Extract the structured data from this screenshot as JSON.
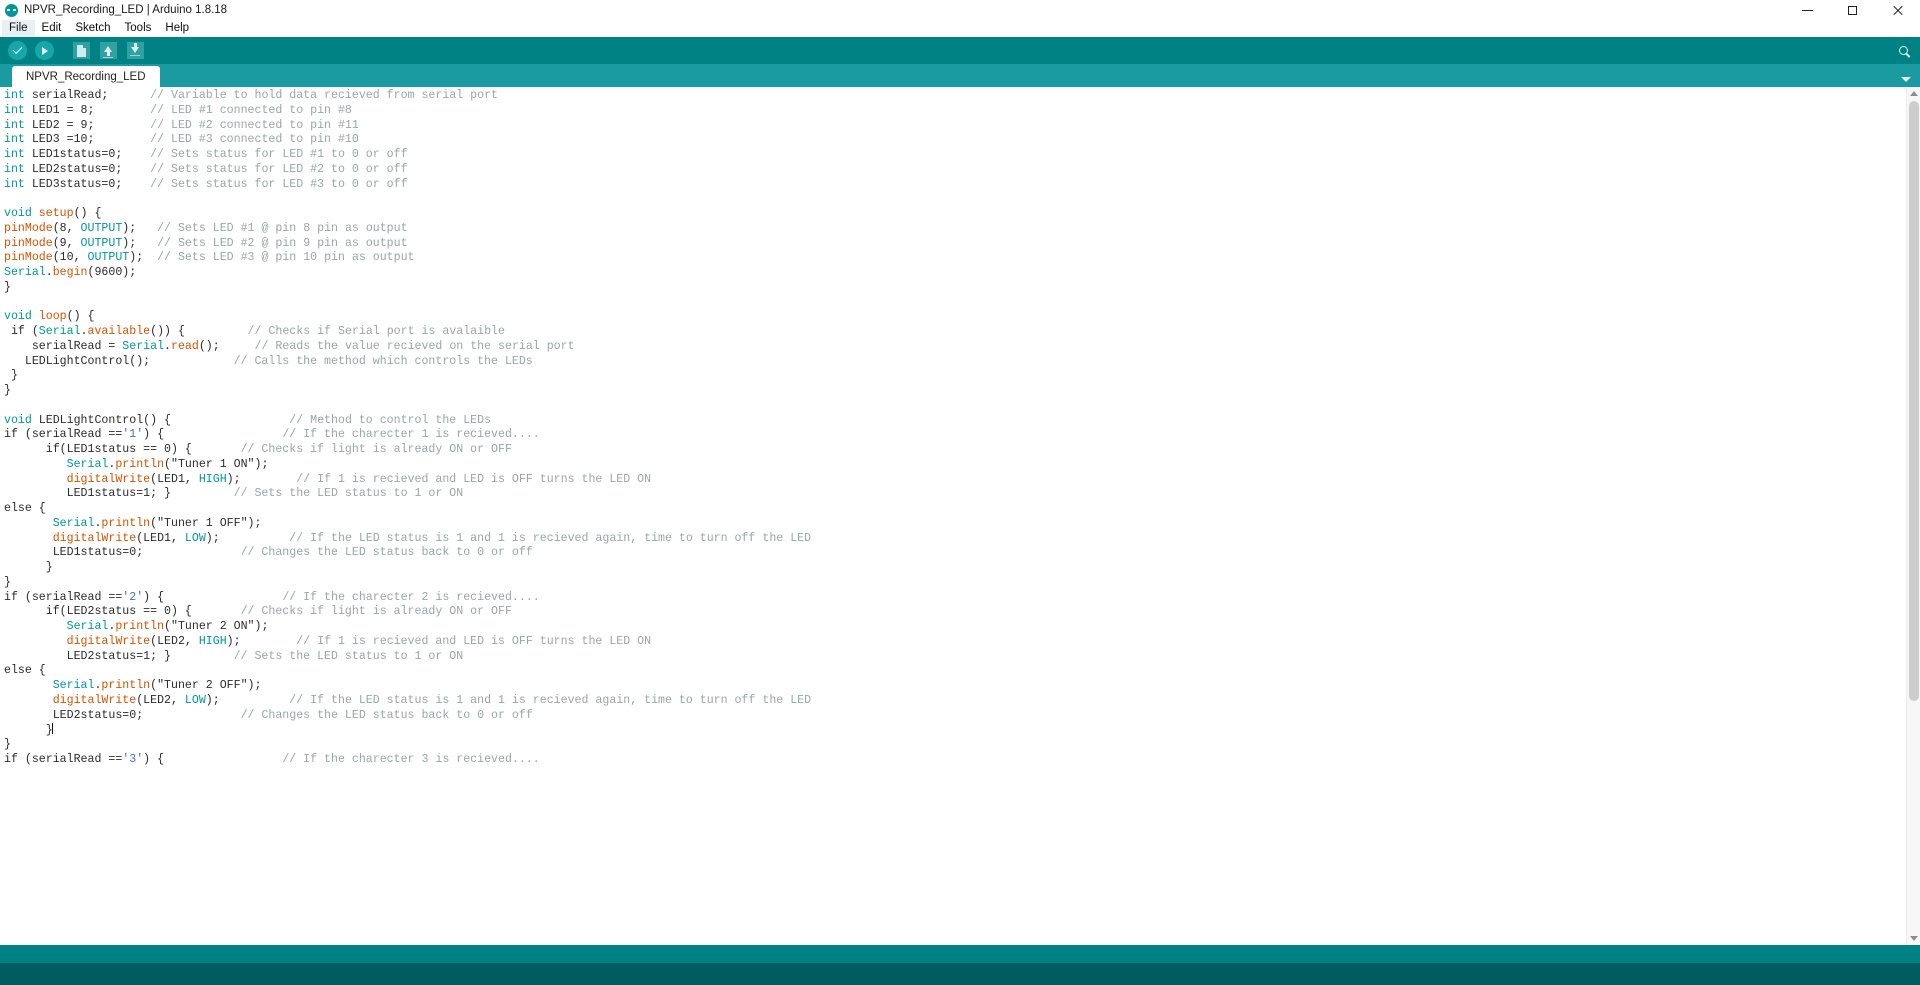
{
  "window": {
    "title": "NPVR_Recording_LED | Arduino 1.8.18",
    "app_icon": "arduino-logo-icon",
    "controls": {
      "minimize": "minimize-icon",
      "maximize": "maximize-icon",
      "close": "close-icon"
    }
  },
  "menubar": {
    "items": [
      {
        "label": "File"
      },
      {
        "label": "Edit"
      },
      {
        "label": "Sketch"
      },
      {
        "label": "Tools"
      },
      {
        "label": "Help"
      }
    ]
  },
  "toolbar": {
    "buttons": [
      {
        "name": "verify-button",
        "icon": "check-circle-icon",
        "tooltip": "Verify"
      },
      {
        "name": "upload-button",
        "icon": "arrow-right-circle-icon",
        "tooltip": "Upload"
      },
      {
        "name": "new-button",
        "icon": "new-document-icon",
        "tooltip": "New"
      },
      {
        "name": "open-button",
        "icon": "arrow-up-icon",
        "tooltip": "Open"
      },
      {
        "name": "save-button",
        "icon": "arrow-down-icon",
        "tooltip": "Save"
      }
    ],
    "serial_monitor": {
      "name": "serial-monitor-button",
      "icon": "magnifier-icon",
      "tooltip": "Serial Monitor"
    }
  },
  "tabs": {
    "active": "NPVR_Recording_LED",
    "items": [
      {
        "label": "NPVR_Recording_LED"
      }
    ],
    "menu_icon": "chevron-down-icon"
  },
  "colors": {
    "toolbar_bg": "#008184",
    "tabbar_bg": "#1a9ba1",
    "status_bg": "#008184",
    "footer_bg": "#005c5f",
    "keyword": "#00979c",
    "function": "#d35400",
    "comment": "#9aa6a6",
    "string": "#2b2b2b",
    "char_literal": "#3f72c4",
    "editor_bg": "#ffffff"
  },
  "editor": {
    "language": "arduino-c",
    "caret_line": 44,
    "lines": [
      [
        {
          "t": "int ",
          "c": "k"
        },
        {
          "t": "serialRead;      ",
          "c": "p"
        },
        {
          "t": "// Variable to hold data recieved from serial port",
          "c": "c"
        }
      ],
      [
        {
          "t": "int ",
          "c": "k"
        },
        {
          "t": "LED1 = 8;        ",
          "c": "p"
        },
        {
          "t": "// LED #1 connected to pin #8",
          "c": "c"
        }
      ],
      [
        {
          "t": "int ",
          "c": "k"
        },
        {
          "t": "LED2 = 9;        ",
          "c": "p"
        },
        {
          "t": "// LED #2 connected to pin #11",
          "c": "c"
        }
      ],
      [
        {
          "t": "int ",
          "c": "k"
        },
        {
          "t": "LED3 =10;        ",
          "c": "p"
        },
        {
          "t": "// LED #3 connected to pin #10",
          "c": "c"
        }
      ],
      [
        {
          "t": "int ",
          "c": "k"
        },
        {
          "t": "LED1status=0;    ",
          "c": "p"
        },
        {
          "t": "// Sets status for LED #1 to 0 or off",
          "c": "c"
        }
      ],
      [
        {
          "t": "int ",
          "c": "k"
        },
        {
          "t": "LED2status=0;    ",
          "c": "p"
        },
        {
          "t": "// Sets status for LED #2 to 0 or off",
          "c": "c"
        }
      ],
      [
        {
          "t": "int ",
          "c": "k"
        },
        {
          "t": "LED3status=0;    ",
          "c": "p"
        },
        {
          "t": "// Sets status for LED #3 to 0 or off",
          "c": "c"
        }
      ],
      [],
      [
        {
          "t": "void ",
          "c": "k"
        },
        {
          "t": "setup",
          "c": "f"
        },
        {
          "t": "() {",
          "c": "p"
        }
      ],
      [
        {
          "t": "pinMode",
          "c": "f"
        },
        {
          "t": "(8, ",
          "c": "p"
        },
        {
          "t": "OUTPUT",
          "c": "k"
        },
        {
          "t": ");   ",
          "c": "p"
        },
        {
          "t": "// Sets LED #1 @ pin 8 pin as output",
          "c": "c"
        }
      ],
      [
        {
          "t": "pinMode",
          "c": "f"
        },
        {
          "t": "(9, ",
          "c": "p"
        },
        {
          "t": "OUTPUT",
          "c": "k"
        },
        {
          "t": ");   ",
          "c": "p"
        },
        {
          "t": "// Sets LED #2 @ pin 9 pin as output",
          "c": "c"
        }
      ],
      [
        {
          "t": "pinMode",
          "c": "f"
        },
        {
          "t": "(10, ",
          "c": "p"
        },
        {
          "t": "OUTPUT",
          "c": "k"
        },
        {
          "t": ");  ",
          "c": "p"
        },
        {
          "t": "// Sets LED #3 @ pin 10 pin as output",
          "c": "c"
        }
      ],
      [
        {
          "t": "Serial",
          "c": "k"
        },
        {
          "t": ".",
          "c": "p"
        },
        {
          "t": "begin",
          "c": "f"
        },
        {
          "t": "(9600);",
          "c": "p"
        }
      ],
      [
        {
          "t": "}",
          "c": "p"
        }
      ],
      [],
      [
        {
          "t": "void ",
          "c": "k"
        },
        {
          "t": "loop",
          "c": "f"
        },
        {
          "t": "() {",
          "c": "p"
        }
      ],
      [
        {
          "t": " if (",
          "c": "p"
        },
        {
          "t": "Serial",
          "c": "k"
        },
        {
          "t": ".",
          "c": "p"
        },
        {
          "t": "available",
          "c": "f"
        },
        {
          "t": "()) {         ",
          "c": "p"
        },
        {
          "t": "// Checks if Serial port is avalaible",
          "c": "c"
        }
      ],
      [
        {
          "t": "    serialRead = ",
          "c": "p"
        },
        {
          "t": "Serial",
          "c": "k"
        },
        {
          "t": ".",
          "c": "p"
        },
        {
          "t": "read",
          "c": "f"
        },
        {
          "t": "();     ",
          "c": "p"
        },
        {
          "t": "// Reads the value recieved on the serial port",
          "c": "c"
        }
      ],
      [
        {
          "t": "   LEDLightControl();            ",
          "c": "p"
        },
        {
          "t": "// Calls the method which controls the LEDs",
          "c": "c"
        }
      ],
      [
        {
          "t": " }",
          "c": "p"
        }
      ],
      [
        {
          "t": "}",
          "c": "p"
        }
      ],
      [],
      [
        {
          "t": "void ",
          "c": "k"
        },
        {
          "t": "LEDLightControl",
          "c": "p"
        },
        {
          "t": "() {                 ",
          "c": "p"
        },
        {
          "t": "// Method to control the LEDs",
          "c": "c"
        }
      ],
      [
        {
          "t": "if (serialRead ==",
          "c": "p"
        },
        {
          "t": "'1'",
          "c": "ch"
        },
        {
          "t": ") {                 ",
          "c": "p"
        },
        {
          "t": "// If the charecter 1 is recieved....",
          "c": "c"
        }
      ],
      [
        {
          "t": "      if(LED1status == 0) {       ",
          "c": "p"
        },
        {
          "t": "// Checks if light is already ON or OFF",
          "c": "c"
        }
      ],
      [
        {
          "t": "         ",
          "c": "p"
        },
        {
          "t": "Serial",
          "c": "k"
        },
        {
          "t": ".",
          "c": "p"
        },
        {
          "t": "println",
          "c": "f"
        },
        {
          "t": "(",
          "c": "p"
        },
        {
          "t": "\"Tuner 1 ON\"",
          "c": "s"
        },
        {
          "t": ");",
          "c": "p"
        }
      ],
      [
        {
          "t": "         ",
          "c": "p"
        },
        {
          "t": "digitalWrite",
          "c": "f"
        },
        {
          "t": "(LED1, ",
          "c": "p"
        },
        {
          "t": "HIGH",
          "c": "k"
        },
        {
          "t": ");        ",
          "c": "p"
        },
        {
          "t": "// If 1 is recieved and LED is OFF turns the LED ON",
          "c": "c"
        }
      ],
      [
        {
          "t": "         LED1status=1; }         ",
          "c": "p"
        },
        {
          "t": "// Sets the LED status to 1 or ON",
          "c": "c"
        }
      ],
      [
        {
          "t": "else {",
          "c": "p"
        }
      ],
      [
        {
          "t": "       ",
          "c": "p"
        },
        {
          "t": "Serial",
          "c": "k"
        },
        {
          "t": ".",
          "c": "p"
        },
        {
          "t": "println",
          "c": "f"
        },
        {
          "t": "(",
          "c": "p"
        },
        {
          "t": "\"Tuner 1 OFF\"",
          "c": "s"
        },
        {
          "t": ");",
          "c": "p"
        }
      ],
      [
        {
          "t": "       ",
          "c": "p"
        },
        {
          "t": "digitalWrite",
          "c": "f"
        },
        {
          "t": "(LED1, ",
          "c": "p"
        },
        {
          "t": "LOW",
          "c": "k"
        },
        {
          "t": ");          ",
          "c": "p"
        },
        {
          "t": "// If the LED status is 1 and 1 is recieved again, time to turn off the LED",
          "c": "c"
        }
      ],
      [
        {
          "t": "       LED1status=0;              ",
          "c": "p"
        },
        {
          "t": "// Changes the LED status back to 0 or off",
          "c": "c"
        }
      ],
      [
        {
          "t": "      }",
          "c": "p"
        }
      ],
      [
        {
          "t": "}",
          "c": "p"
        }
      ],
      [
        {
          "t": "if (serialRead ==",
          "c": "p"
        },
        {
          "t": "'2'",
          "c": "ch"
        },
        {
          "t": ") {                 ",
          "c": "p"
        },
        {
          "t": "// If the charecter 2 is recieved....",
          "c": "c"
        }
      ],
      [
        {
          "t": "      if(LED2status == 0) {       ",
          "c": "p"
        },
        {
          "t": "// Checks if light is already ON or OFF",
          "c": "c"
        }
      ],
      [
        {
          "t": "         ",
          "c": "p"
        },
        {
          "t": "Serial",
          "c": "k"
        },
        {
          "t": ".",
          "c": "p"
        },
        {
          "t": "println",
          "c": "f"
        },
        {
          "t": "(",
          "c": "p"
        },
        {
          "t": "\"Tuner 2 ON\"",
          "c": "s"
        },
        {
          "t": ");",
          "c": "p"
        }
      ],
      [
        {
          "t": "         ",
          "c": "p"
        },
        {
          "t": "digitalWrite",
          "c": "f"
        },
        {
          "t": "(LED2, ",
          "c": "p"
        },
        {
          "t": "HIGH",
          "c": "k"
        },
        {
          "t": ");        ",
          "c": "p"
        },
        {
          "t": "// If 1 is recieved and LED is OFF turns the LED ON",
          "c": "c"
        }
      ],
      [
        {
          "t": "         LED2status=1; }         ",
          "c": "p"
        },
        {
          "t": "// Sets the LED status to 1 or ON",
          "c": "c"
        }
      ],
      [
        {
          "t": "else {",
          "c": "p"
        }
      ],
      [
        {
          "t": "       ",
          "c": "p"
        },
        {
          "t": "Serial",
          "c": "k"
        },
        {
          "t": ".",
          "c": "p"
        },
        {
          "t": "println",
          "c": "f"
        },
        {
          "t": "(",
          "c": "p"
        },
        {
          "t": "\"Tuner 2 OFF\"",
          "c": "s"
        },
        {
          "t": ");",
          "c": "p"
        }
      ],
      [
        {
          "t": "       ",
          "c": "p"
        },
        {
          "t": "digitalWrite",
          "c": "f"
        },
        {
          "t": "(LED2, ",
          "c": "p"
        },
        {
          "t": "LOW",
          "c": "k"
        },
        {
          "t": ");          ",
          "c": "p"
        },
        {
          "t": "// If the LED status is 1 and 1 is recieved again, time to turn off the LED",
          "c": "c"
        }
      ],
      [
        {
          "t": "       LED2status=0;              ",
          "c": "p"
        },
        {
          "t": "// Changes the LED status back to 0 or off",
          "c": "c"
        }
      ],
      [
        {
          "t": "      }",
          "c": "p",
          "caret": true
        }
      ],
      [
        {
          "t": "}",
          "c": "p"
        }
      ],
      [
        {
          "t": "if (serialRead ==",
          "c": "p"
        },
        {
          "t": "'3'",
          "c": "ch"
        },
        {
          "t": ") {                 ",
          "c": "p"
        },
        {
          "t": "// If the charecter 3 is recieved....",
          "c": "c"
        }
      ]
    ]
  },
  "scrollbar": {
    "name": "vertical-scrollbar",
    "up_icon": "caret-up-icon",
    "down_icon": "caret-down-icon"
  }
}
